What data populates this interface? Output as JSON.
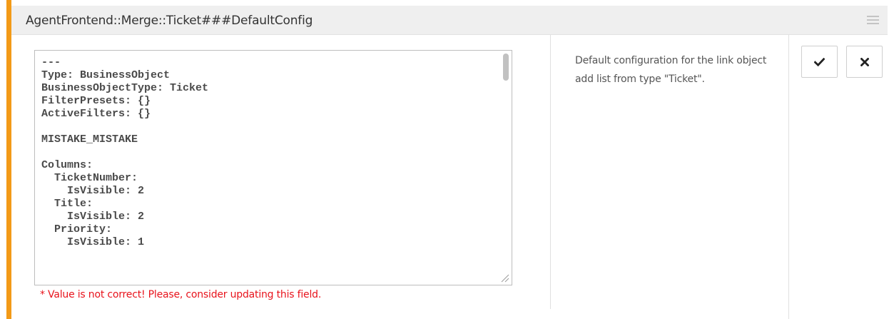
{
  "header": {
    "title": "AgentFrontend::Merge::Ticket###DefaultConfig"
  },
  "editor": {
    "code": "---\nType: BusinessObject\nBusinessObjectType: Ticket\nFilterPresets: {}\nActiveFilters: {}\n\nMISTAKE_MISTAKE\n\nColumns:\n  TicketNumber:\n    IsVisible: 2\n  Title:\n    IsVisible: 2\n  Priority:\n    IsVisible: 1",
    "error": "* Value is not correct! Please, consider updating this field."
  },
  "description": {
    "text": "Default configuration for the link object add list from type \"Ticket\"."
  },
  "actions": {
    "save_icon": "checkmark-icon",
    "cancel_icon": "close-icon"
  },
  "colors": {
    "accent": "#f39a17",
    "error": "#e8131c",
    "header_bg": "#efefef"
  }
}
